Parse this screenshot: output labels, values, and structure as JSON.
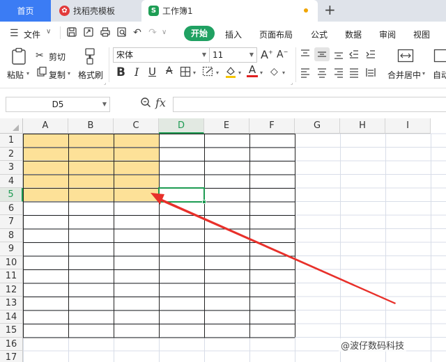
{
  "tabs": {
    "home": "首页",
    "template": "找稻壳模板",
    "workbook": "工作簿1",
    "plus": "+"
  },
  "menu": {
    "file": "文件",
    "items": [
      "开始",
      "插入",
      "页面布局",
      "公式",
      "数据",
      "审阅",
      "视图"
    ]
  },
  "ribbon": {
    "paste": "粘贴",
    "cut": "剪切",
    "copy": "复制",
    "format_painter": "格式刷",
    "font_name": "宋体",
    "font_size": "11",
    "bold": "B",
    "italic": "I",
    "underline": "U",
    "merge": "合并居中",
    "auto": "自动"
  },
  "formula": {
    "name_box": "D5",
    "fx": "fx",
    "content": ""
  },
  "sheet": {
    "columns": [
      "A",
      "B",
      "C",
      "D",
      "E",
      "F",
      "G",
      "H",
      "I"
    ],
    "rows": [
      "1",
      "2",
      "3",
      "4",
      "5",
      "6",
      "7",
      "8",
      "9",
      "10",
      "11",
      "12",
      "13",
      "14",
      "15",
      "16",
      "17"
    ],
    "active_cell": "D5",
    "highlight_color": "#fde198",
    "arrow_color": "#e8302a"
  },
  "watermark": "@波仔数码科技"
}
